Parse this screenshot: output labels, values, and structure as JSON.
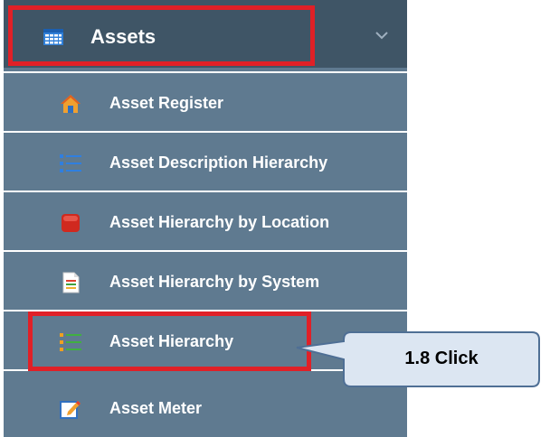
{
  "menu": {
    "header": {
      "label": "Assets",
      "icon": "table-icon",
      "expand_icon": "chevron-down-icon"
    },
    "items": [
      {
        "label": "Asset Register",
        "icon": "house-icon"
      },
      {
        "label": "Asset Description Hierarchy",
        "icon": "list-icon"
      },
      {
        "label": "Asset Hierarchy by Location",
        "icon": "red-box-icon"
      },
      {
        "label": "Asset Hierarchy by System",
        "icon": "document-icon"
      },
      {
        "label": "Asset Hierarchy",
        "icon": "hierarchy-list-icon"
      },
      {
        "label": "Asset Meter",
        "icon": "edit-icon"
      }
    ]
  },
  "callout": {
    "text": "1.8 Click"
  },
  "colors": {
    "header_bg": "#3f5566",
    "item_bg": "#5f7a90",
    "highlight": "#e02027",
    "callout_fill": "#dce6f2",
    "callout_stroke": "#4f6f95"
  }
}
